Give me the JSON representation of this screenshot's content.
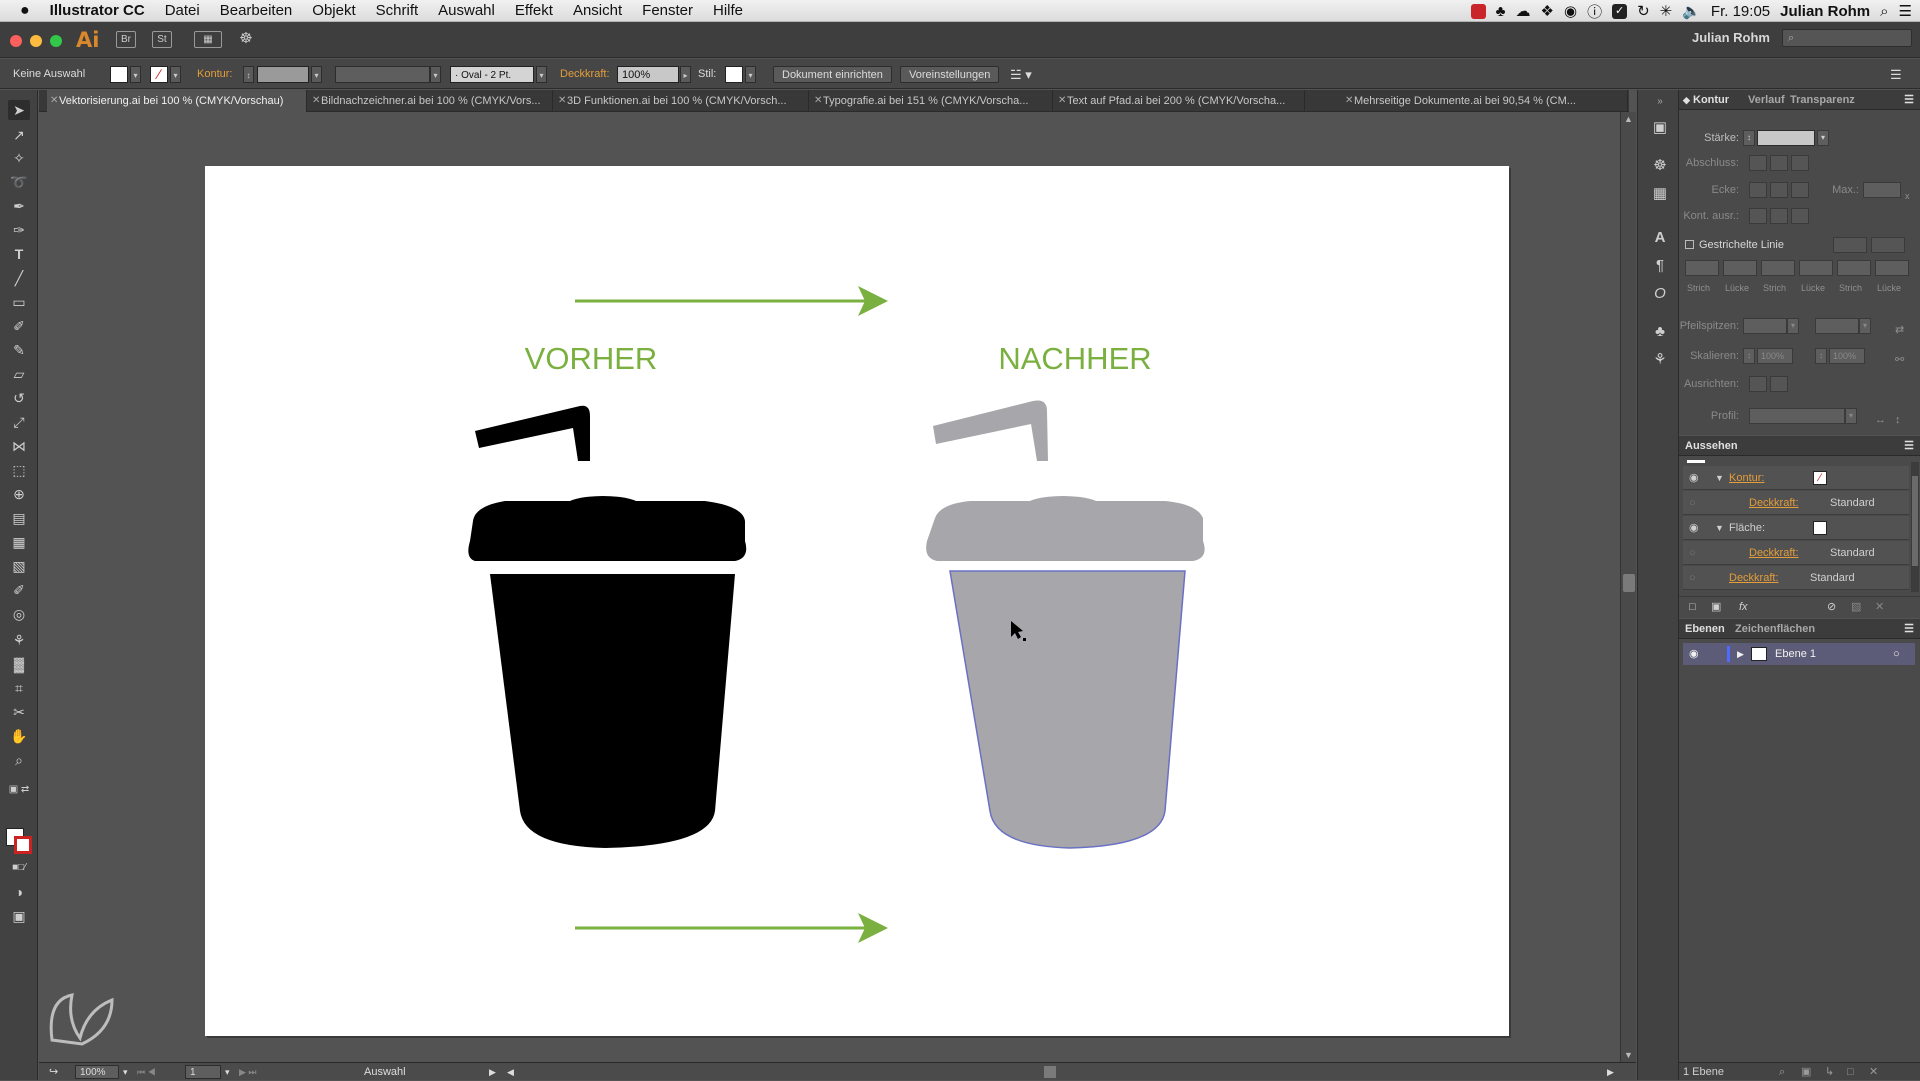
{
  "menubar": {
    "apple": "",
    "app_name": "Illustrator CC",
    "items": [
      "Datei",
      "Bearbeiten",
      "Objekt",
      "Schrift",
      "Auswahl",
      "Effekt",
      "Ansicht",
      "Fenster",
      "Hilfe"
    ],
    "clock": "Fr. 19:05",
    "user": "Julian Rohm"
  },
  "titlebar": {
    "app_badge": "Ai",
    "br": "Br",
    "st": "St",
    "user": "Julian Rohm"
  },
  "control_bar": {
    "selection": "Keine Auswahl",
    "kontur_label": "Kontur:",
    "brush": "Oval - 2 Pt.",
    "deckkraft_label": "Deckkraft:",
    "deckkraft_value": "100%",
    "stil_label": "Stil:",
    "dokument_button": "Dokument einrichten",
    "voreinstellungen_button": "Voreinstellungen"
  },
  "tabs": [
    {
      "label": "Vektorisierung.ai bei 100 % (CMYK/Vorschau)",
      "active": true
    },
    {
      "label": "Bildnachzeichner.ai bei 100 % (CMYK/Vors...",
      "active": false
    },
    {
      "label": "3D Funktionen.ai bei 100 % (CMYK/Vorsch...",
      "active": false
    },
    {
      "label": "Typografie.ai bei 151 % (CMYK/Vorscha...",
      "active": false
    },
    {
      "label": "Text auf Pfad.ai bei 200 % (CMYK/Vorscha...",
      "active": false
    },
    {
      "label": "Mehrseitige Dokumente.ai bei 90,54 % (CM...",
      "active": false
    }
  ],
  "artboard": {
    "label_before": "VORHER",
    "label_after": "NACHHER",
    "accent_color": "#7ab03f",
    "before_fill": "#000000",
    "after_fill": "#a7a7ab"
  },
  "status_bar": {
    "zoom": "100%",
    "artboard_number": "1",
    "tool": "Auswahl"
  },
  "kontur_panel": {
    "tabs": [
      "Kontur",
      "Verlauf",
      "Transparenz"
    ],
    "staerke": "Stärke:",
    "abschluss": "Abschluss:",
    "ecke": "Ecke:",
    "max": "Max.:",
    "kont_ausr": "Kont. ausr.:",
    "gestrichelte_linie": "Gestrichelte Linie",
    "dash_labels": [
      "Strich",
      "Lücke",
      "Strich",
      "Lücke",
      "Strich",
      "Lücke"
    ],
    "pfeilspitzen": "Pfeilspitzen:",
    "skalieren": "Skalieren:",
    "skalieren_values": [
      "100%",
      "100%"
    ],
    "ausrichten": "Ausrichten:",
    "profil": "Profil:"
  },
  "aussehen_panel": {
    "title": "Aussehen",
    "kontur_label": "Kontur:",
    "deckkraft_label": "Deckkraft:",
    "deckkraft_value": "Standard",
    "flaeche_label": "Fläche:",
    "fx": "fx"
  },
  "ebenen_panel": {
    "tabs": [
      "Ebenen",
      "Zeichenflächen"
    ],
    "layer_name": "Ebene 1",
    "footer": "1 Ebene"
  }
}
